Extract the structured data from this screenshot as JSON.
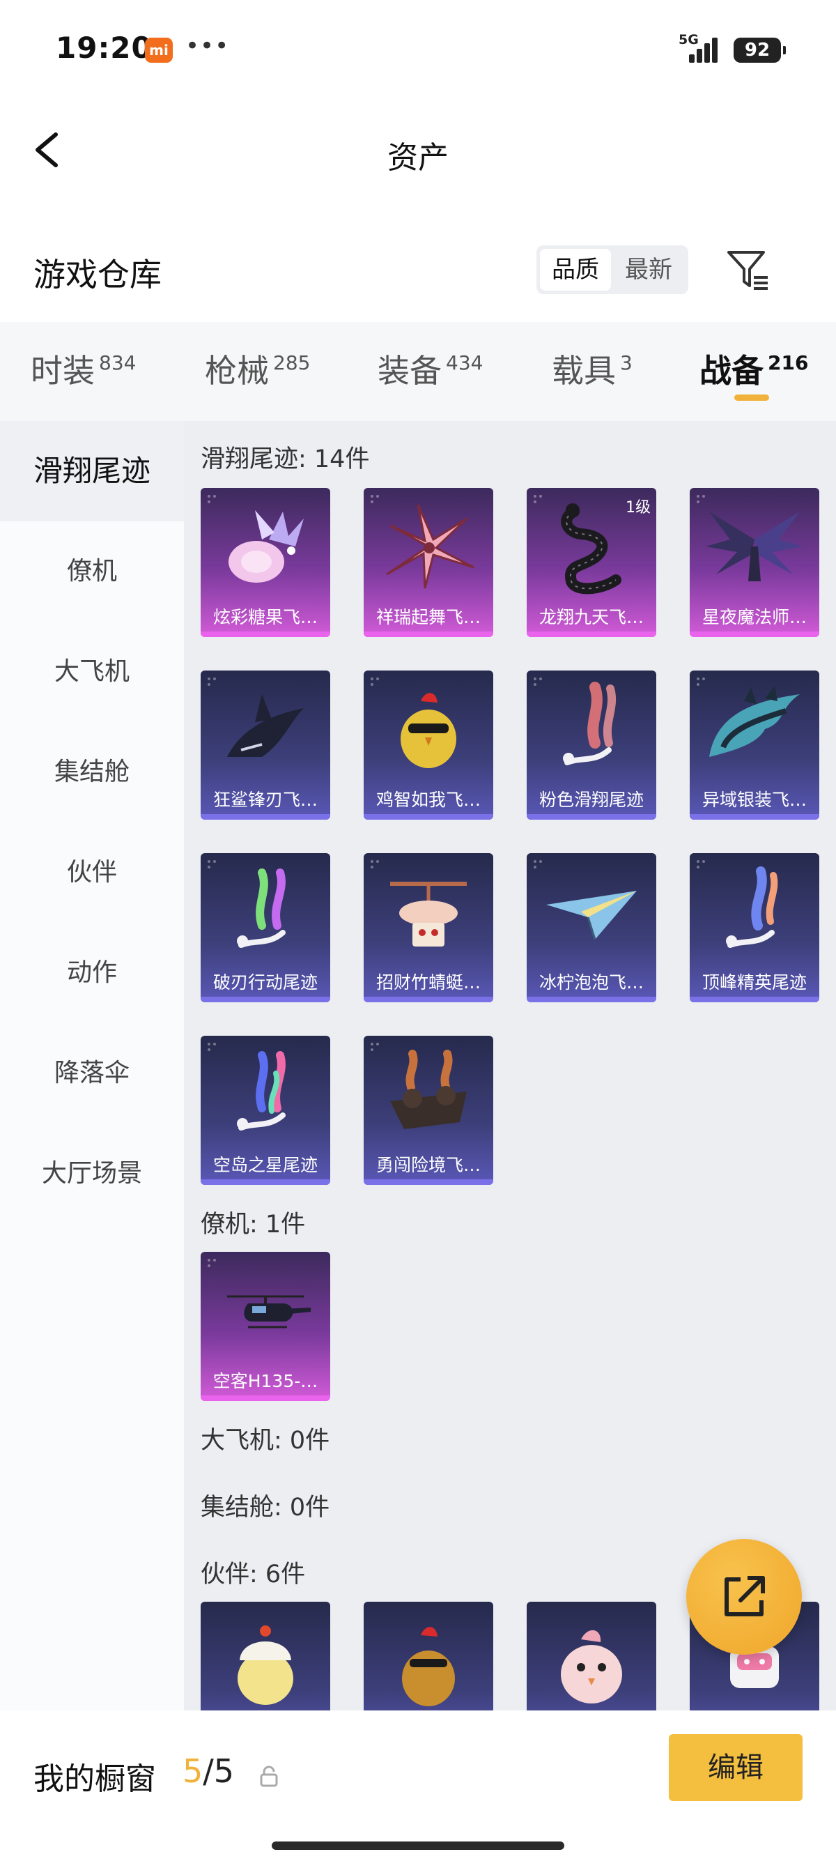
{
  "status_bar": {
    "time": "19:20",
    "mi_badge": "mi",
    "dots": "•••",
    "network": "5G",
    "battery": "92"
  },
  "header": {
    "title": "资产"
  },
  "warehouse": {
    "title": "游戏仓库",
    "sort_quality": "品质",
    "sort_newest": "最新"
  },
  "tabs": [
    {
      "label": "时装",
      "count": "834"
    },
    {
      "label": "枪械",
      "count": "285"
    },
    {
      "label": "装备",
      "count": "434"
    },
    {
      "label": "载具",
      "count": "3"
    },
    {
      "label": "战备",
      "count": "216"
    }
  ],
  "sidebar": [
    "滑翔尾迹",
    "僚机",
    "大飞机",
    "集结舱",
    "伙伴",
    "动作",
    "降落伞",
    "大厅场景"
  ],
  "sections": {
    "glide": {
      "heading": "滑翔尾迹: 14件",
      "items": [
        "炫彩糖果飞…",
        "祥瑞起舞飞…",
        "龙翔九天飞…",
        "星夜魔法师…",
        "狂鲨锋刃飞…",
        "鸡智如我飞…",
        "粉色滑翔尾迹",
        "异域银装飞…",
        "破刃行动尾迹",
        "招财竹蜻蜓…",
        "冰柠泡泡飞…",
        "顶峰精英尾迹",
        "空岛之星尾迹",
        "勇闯险境飞…"
      ],
      "level_badge": "1级"
    },
    "wingman": {
      "heading": "僚机: 1件",
      "items": [
        "空客H135-…"
      ]
    },
    "bigplane": {
      "heading": "大飞机: 0件"
    },
    "capsule": {
      "heading": "集结舱: 0件"
    },
    "partner": {
      "heading": "伙伴: 6件"
    }
  },
  "bottom_bar": {
    "title": "我的橱窗",
    "count_current": "5",
    "count_total": "/5",
    "edit_label": "编辑"
  },
  "colors": {
    "accent": "#f0b23a",
    "edit_button": "#f4be3e",
    "card_purple": "#ea63ec",
    "card_blue": "#7a70e8"
  }
}
